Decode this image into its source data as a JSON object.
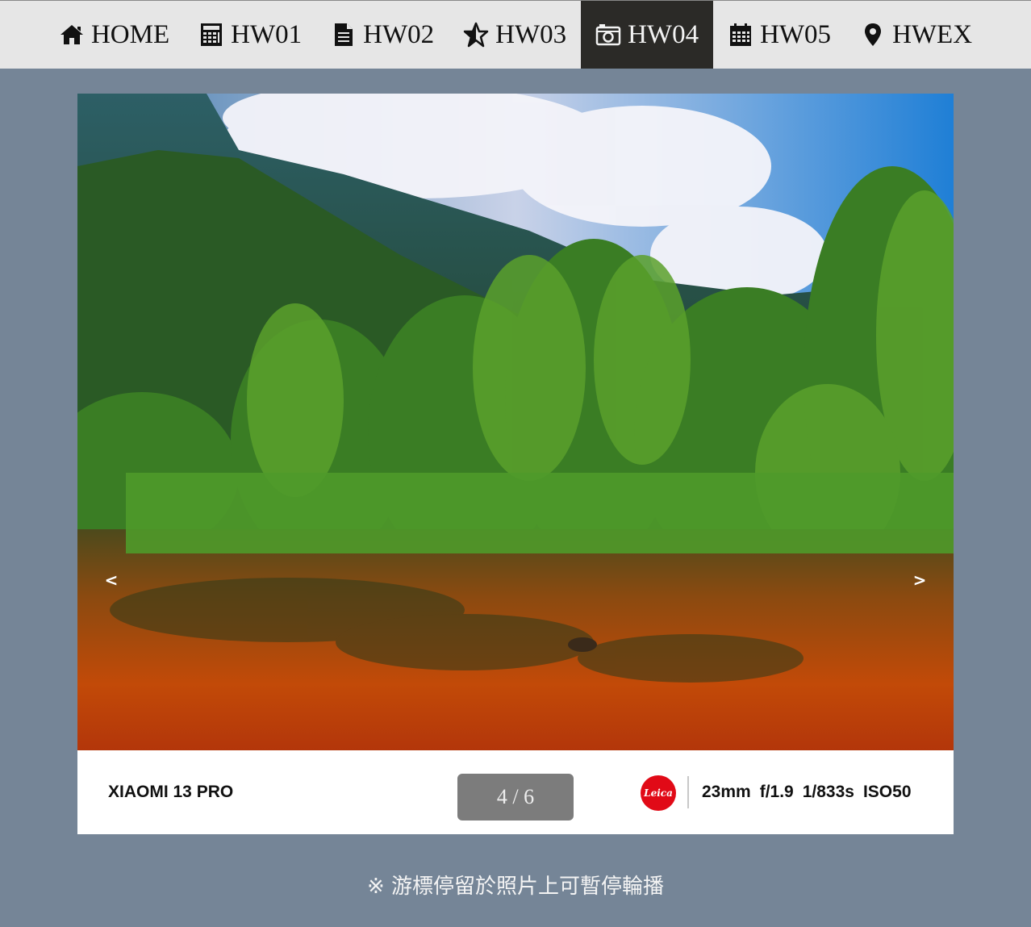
{
  "nav": {
    "items": [
      {
        "label": "HOME",
        "icon": "home-icon"
      },
      {
        "label": "HW01",
        "icon": "calculator-icon"
      },
      {
        "label": "HW02",
        "icon": "document-icon"
      },
      {
        "label": "HW03",
        "icon": "star-half-icon"
      },
      {
        "label": "HW04",
        "icon": "camera-icon"
      },
      {
        "label": "HW05",
        "icon": "calendar-icon"
      },
      {
        "label": "HWEX",
        "icon": "map-pin-icon"
      }
    ],
    "active": "HW04",
    "active_bg": "#2b2a27"
  },
  "slideshow": {
    "prev_label": "<",
    "next_label": ">",
    "device": "XIAOMI 13 PRO",
    "counter": "4 / 6",
    "leica_logo_text": "Leica",
    "exif": {
      "focal": "23mm",
      "aperture": "f/1.9",
      "shutter": "1/833s",
      "iso": "ISO50"
    }
  },
  "hint": "※ 游標停留於照片上可暫停輪播",
  "colors": {
    "page_bg": "#758597",
    "nav_bg": "#e6e6e6",
    "counter_bg": "#7c7c7c",
    "leica_red": "#e10a17"
  }
}
